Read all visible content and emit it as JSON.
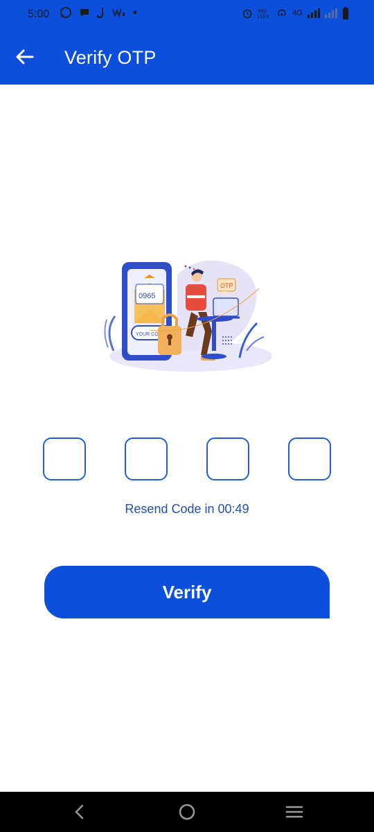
{
  "status_bar": {
    "time": "5:00",
    "left_icons": [
      "whatsapp-icon",
      "chat-icon",
      "j-app-icon",
      "w-app-icon",
      "dot-icon"
    ],
    "right_icons": [
      "alarm-icon",
      "volte-icon",
      "hotspot-icon",
      "signal-4g-icon",
      "signal-icon",
      "battery-icon"
    ],
    "network": "4G",
    "volte_text": "Vo)) LTE1"
  },
  "app_bar": {
    "title": "Verify OTP",
    "back_icon": "arrow-left-icon"
  },
  "illustration": {
    "code_text": "0965",
    "card_text": "YOUR CODE",
    "bubble_text": "OTP"
  },
  "otp": {
    "digits": [
      "",
      "",
      "",
      ""
    ]
  },
  "resend": {
    "label": "Resend Code in",
    "timer": "00:49"
  },
  "verify_button": {
    "label": "Verify"
  },
  "colors": {
    "primary": "#0b4fdb",
    "otp_border": "#1f5ed6",
    "resend_text": "#1e4fb3"
  },
  "nav_bar": {
    "items": [
      "back-nav-icon",
      "home-nav-icon",
      "recents-nav-icon"
    ]
  }
}
